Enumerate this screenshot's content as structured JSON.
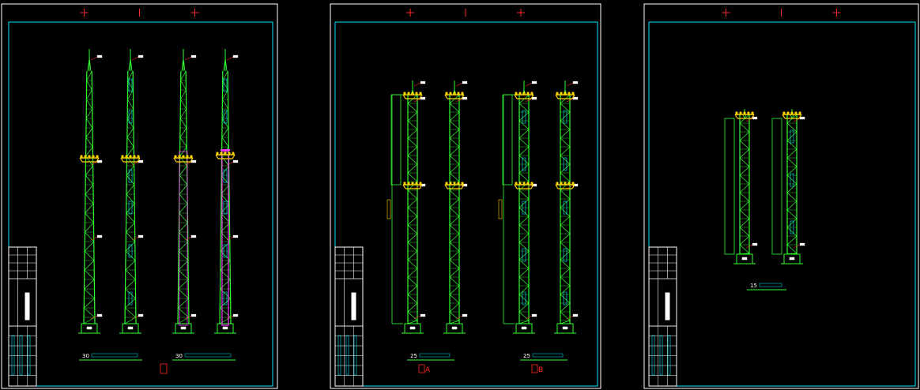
{
  "colors": {
    "background": "#000000",
    "sheet_border": "#ffffff",
    "inner_border": "#00e5ff",
    "mast": "#33ff33",
    "lamp": "#ffd500",
    "dimension": "#00e5ff",
    "marker": "#ff2a2a",
    "highlight": "#ff33ff"
  },
  "sheets": [
    {
      "captions": [
        "30",
        "30"
      ],
      "red_label": "",
      "masts": 4
    },
    {
      "captions": [
        "25",
        "25"
      ],
      "red_labels": [
        "A",
        "B"
      ],
      "masts": 4
    },
    {
      "captions": [
        "15"
      ],
      "masts": 2
    }
  ]
}
